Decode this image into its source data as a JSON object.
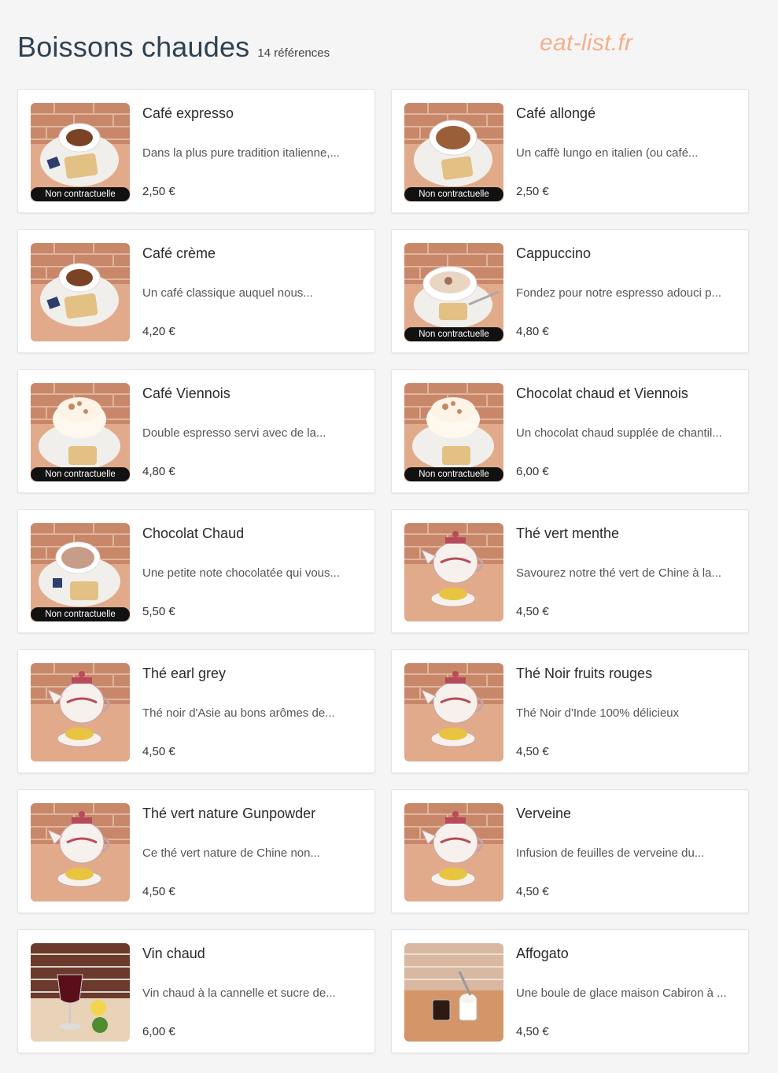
{
  "header": {
    "title": "Boissons chaudes",
    "count": "14 références"
  },
  "watermark": "eat-list.fr",
  "badge_label": "Non contractuelle",
  "items": [
    {
      "name": "Café expresso",
      "desc": "Dans la plus pure tradition italienne,...",
      "price": "2,50 €",
      "img": "coffee",
      "badge": true
    },
    {
      "name": "Café allongé",
      "desc": "Un caffè lungo en italien (ou café...",
      "price": "2,50 €",
      "img": "coffee-large",
      "badge": true
    },
    {
      "name": "Café crème",
      "desc": "Un café classique auquel nous...",
      "price": "4,20 €",
      "img": "coffee",
      "badge": false
    },
    {
      "name": "Cappuccino",
      "desc": "Fondez pour notre espresso adouci p...",
      "price": "4,80 €",
      "img": "cappuccino",
      "badge": true
    },
    {
      "name": "Café Viennois",
      "desc": "Double espresso servi avec de la...",
      "price": "4,80 €",
      "img": "cream",
      "badge": true
    },
    {
      "name": "Chocolat chaud et Viennois",
      "desc": "Un chocolat chaud supplée de chantil...",
      "price": "6,00 €",
      "img": "cream",
      "badge": true
    },
    {
      "name": "Chocolat Chaud",
      "desc": "Une petite note chocolatée qui vous...",
      "price": "5,50 €",
      "img": "chocolate",
      "badge": true
    },
    {
      "name": "Thé vert menthe",
      "desc": "Savourez notre thé vert de Chine à la...",
      "price": "4,50 €",
      "img": "tea",
      "badge": false
    },
    {
      "name": "Thé earl grey",
      "desc": "Thé noir d'Asie au bons arômes de...",
      "price": "4,50 €",
      "img": "tea",
      "badge": false
    },
    {
      "name": "Thé Noir fruits rouges",
      "desc": "Thé Noir d'Inde 100% délicieux",
      "price": "4,50 €",
      "img": "tea",
      "badge": false
    },
    {
      "name": "Thé vert nature Gunpowder",
      "desc": "Ce thé vert nature de Chine non...",
      "price": "4,50 €",
      "img": "tea",
      "badge": false
    },
    {
      "name": "Verveine",
      "desc": "Infusion de feuilles de verveine du...",
      "price": "4,50 €",
      "img": "tea",
      "badge": false
    },
    {
      "name": "Vin chaud",
      "desc": "Vin chaud à la cannelle et sucre de...",
      "price": "6,00 €",
      "img": "wine",
      "badge": false
    },
    {
      "name": "Affogato",
      "desc": "Une boule de glace maison Cabiron à ...",
      "price": "4,50 €",
      "img": "affogato",
      "badge": false
    }
  ]
}
